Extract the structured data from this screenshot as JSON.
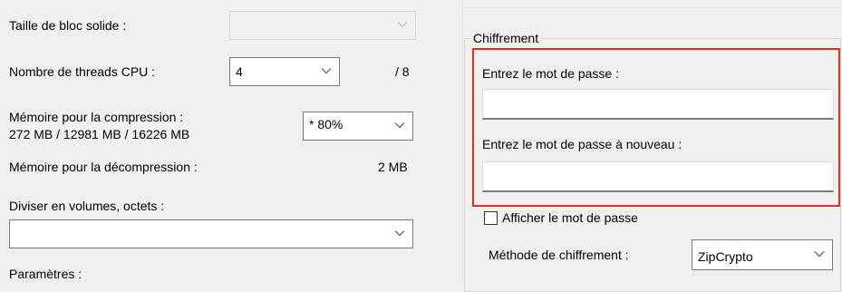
{
  "left_panel": {
    "solid_block_label": "Taille de bloc solide :",
    "threads_label": "Nombre de threads CPU :",
    "threads_value": "4",
    "threads_total": "/ 8",
    "compress_mem_label": "Mémoire pour la compression :",
    "compress_mem_values": "272 MB / 12981 MB / 16226 MB",
    "compress_mem_select": "* 80%",
    "decompress_mem_label": "Mémoire pour la décompression :",
    "decompress_mem_value": "2 MB",
    "split_label": "Diviser en volumes, octets :",
    "split_value": "",
    "params_label": "Paramètres :"
  },
  "encryption": {
    "group_title": "Chiffrement",
    "password_label": "Entrez le mot de passe :",
    "password_value": "",
    "password_confirm_label": "Entrez le mot de passe à nouveau :",
    "password_confirm_value": "",
    "show_password_label": "Afficher le mot de passe",
    "show_password_checked": false,
    "method_label": "Méthode de chiffrement :",
    "method_value": "ZipCrypto"
  },
  "colors": {
    "highlight": "#e0301e",
    "window_bg": "#f0f0f0"
  }
}
